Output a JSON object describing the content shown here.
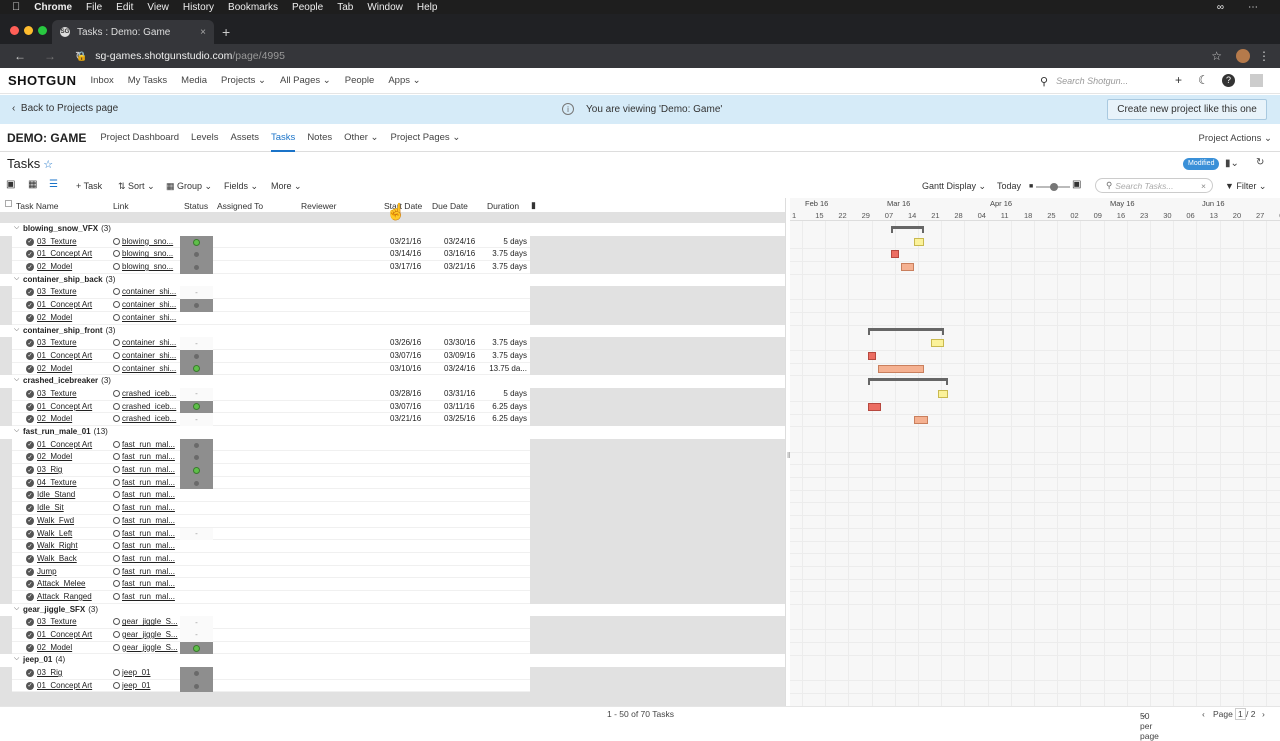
{
  "macbar": {
    "apple": "",
    "app": "Chrome",
    "menus": [
      "File",
      "Edit",
      "View",
      "History",
      "Bookmarks",
      "People",
      "Tab",
      "Window",
      "Help"
    ]
  },
  "browser": {
    "tab_title": "Tasks : Demo: Game",
    "favicon_text": "SG",
    "url_host": "sg-games.shotgunstudio.com",
    "url_path": "/page/4995"
  },
  "sgnav": {
    "logo": "SHOTGUN",
    "links": [
      "Inbox",
      "My Tasks",
      "Media",
      "Projects",
      "All Pages",
      "People",
      "Apps"
    ],
    "search_placeholder": "Search Shotgun..."
  },
  "banner": {
    "back": "Back to Projects page",
    "viewing": "You are viewing 'Demo: Game'",
    "create": "Create new project like this one"
  },
  "project": {
    "name": "DEMO: GAME",
    "tabs": [
      "Project Dashboard",
      "Levels",
      "Assets",
      "Tasks",
      "Notes",
      "Other",
      "Project Pages"
    ],
    "active_tab": "Tasks",
    "actions": "Project Actions"
  },
  "page": {
    "title": "Tasks",
    "modified": "Modified"
  },
  "toolbar": {
    "task": "+ Task",
    "sort": "Sort",
    "group": "Group",
    "fields": "Fields",
    "more": "More",
    "gantt_display": "Gantt Display",
    "today": "Today",
    "search_placeholder": "Search Tasks...",
    "filter": "Filter"
  },
  "columns": [
    "Task Name",
    "Link",
    "Status",
    "Assigned To",
    "Reviewer",
    "Start Date",
    "Due Date",
    "Duration"
  ],
  "groups": [
    {
      "name": "blowing_snow_VFX",
      "count": "(3)",
      "tasks": [
        {
          "name": "03_Texture",
          "link": "blowing_sno...",
          "status": "green",
          "start": "03/21/16",
          "due": "03/24/16",
          "dur": "5 days"
        },
        {
          "name": "01_Concept Art",
          "link": "blowing_sno...",
          "status": "grey",
          "start": "03/14/16",
          "due": "03/16/16",
          "dur": "3.75 days"
        },
        {
          "name": "02_Model",
          "link": "blowing_sno...",
          "status": "grey",
          "start": "03/17/16",
          "due": "03/21/16",
          "dur": "3.75 days"
        }
      ]
    },
    {
      "name": "container_ship_back",
      "count": "(3)",
      "tasks": [
        {
          "name": "03_Texture",
          "link": "container_shi...",
          "status": "dash",
          "start": "",
          "due": "",
          "dur": ""
        },
        {
          "name": "01_Concept Art",
          "link": "container_shi...",
          "status": "grey",
          "start": "",
          "due": "",
          "dur": ""
        },
        {
          "name": "02_Model",
          "link": "container_shi...",
          "status": "none",
          "start": "",
          "due": "",
          "dur": ""
        }
      ]
    },
    {
      "name": "container_ship_front",
      "count": "(3)",
      "tasks": [
        {
          "name": "03_Texture",
          "link": "container_shi...",
          "status": "dash",
          "start": "03/26/16",
          "due": "03/30/16",
          "dur": "3.75 days"
        },
        {
          "name": "01_Concept Art",
          "link": "container_shi...",
          "status": "grey",
          "start": "03/07/16",
          "due": "03/09/16",
          "dur": "3.75 days"
        },
        {
          "name": "02_Model",
          "link": "container_shi...",
          "status": "green",
          "start": "03/10/16",
          "due": "03/24/16",
          "dur": "13.75 da..."
        }
      ]
    },
    {
      "name": "crashed_icebreaker",
      "count": "(3)",
      "tasks": [
        {
          "name": "03_Texture",
          "link": "crashed_iceb...",
          "status": "dash",
          "start": "03/28/16",
          "due": "03/31/16",
          "dur": "5 days"
        },
        {
          "name": "01_Concept Art",
          "link": "crashed_iceb...",
          "status": "green",
          "start": "03/07/16",
          "due": "03/11/16",
          "dur": "6.25 days"
        },
        {
          "name": "02_Model",
          "link": "crashed_iceb...",
          "status": "dash",
          "start": "03/21/16",
          "due": "03/25/16",
          "dur": "6.25 days"
        }
      ]
    },
    {
      "name": "fast_run_male_01",
      "count": "(13)",
      "tasks": [
        {
          "name": "01_Concept Art",
          "link": "fast_run_mal...",
          "status": "grey",
          "start": "",
          "due": "",
          "dur": ""
        },
        {
          "name": "02_Model",
          "link": "fast_run_mal...",
          "status": "grey",
          "start": "",
          "due": "",
          "dur": ""
        },
        {
          "name": "03_Rig",
          "link": "fast_run_mal...",
          "status": "green",
          "start": "",
          "due": "",
          "dur": ""
        },
        {
          "name": "04_Texture",
          "link": "fast_run_mal...",
          "status": "grey",
          "start": "",
          "due": "",
          "dur": ""
        },
        {
          "name": "Idle_Stand",
          "link": "fast_run_mal...",
          "status": "none",
          "start": "",
          "due": "",
          "dur": ""
        },
        {
          "name": "Idle_Sit",
          "link": "fast_run_mal...",
          "status": "none",
          "start": "",
          "due": "",
          "dur": ""
        },
        {
          "name": "Walk_Fwd",
          "link": "fast_run_mal...",
          "status": "none",
          "start": "",
          "due": "",
          "dur": ""
        },
        {
          "name": "Walk_Left",
          "link": "fast_run_mal...",
          "status": "dash",
          "start": "",
          "due": "",
          "dur": ""
        },
        {
          "name": "Walk_Right",
          "link": "fast_run_mal...",
          "status": "none",
          "start": "",
          "due": "",
          "dur": ""
        },
        {
          "name": "Walk_Back",
          "link": "fast_run_mal...",
          "status": "none",
          "start": "",
          "due": "",
          "dur": ""
        },
        {
          "name": "Jump",
          "link": "fast_run_mal...",
          "status": "none",
          "start": "",
          "due": "",
          "dur": ""
        },
        {
          "name": "Attack_Melee",
          "link": "fast_run_mal...",
          "status": "none",
          "start": "",
          "due": "",
          "dur": ""
        },
        {
          "name": "Attack_Ranged",
          "link": "fast_run_mal...",
          "status": "none",
          "start": "",
          "due": "",
          "dur": ""
        }
      ]
    },
    {
      "name": "gear_jiggle_SFX",
      "count": "(3)",
      "tasks": [
        {
          "name": "03_Texture",
          "link": "gear_jiggle_S...",
          "status": "dash",
          "start": "",
          "due": "",
          "dur": ""
        },
        {
          "name": "01_Concept Art",
          "link": "gear_jiggle_S...",
          "status": "dash",
          "start": "",
          "due": "",
          "dur": ""
        },
        {
          "name": "02_Model",
          "link": "gear_jiggle_S...",
          "status": "green",
          "start": "",
          "due": "",
          "dur": ""
        }
      ]
    },
    {
      "name": "jeep_01",
      "count": "(4)",
      "tasks": [
        {
          "name": "03_Rig",
          "link": "jeep_01",
          "status": "grey",
          "start": "",
          "due": "",
          "dur": ""
        },
        {
          "name": "01_Concept Art",
          "link": "jeep_01",
          "status": "grey",
          "start": "",
          "due": "",
          "dur": ""
        }
      ]
    }
  ],
  "gantt": {
    "months": [
      "Feb 16",
      "Mar 16",
      "Apr 16",
      "May 16",
      "Jun 16"
    ],
    "days": [
      "1",
      "15",
      "22",
      "29",
      "07",
      "14",
      "21",
      "28",
      "04",
      "11",
      "18",
      "25",
      "02",
      "09",
      "16",
      "23",
      "30",
      "06",
      "13",
      "20",
      "27",
      "04"
    ]
  },
  "footer": {
    "count": "1 - 50 of 70 Tasks",
    "per_page": "50 per page",
    "page_label": "Page",
    "page": "1",
    "of": "/ 2"
  },
  "colors": {
    "accent": "#1a73c8",
    "banner": "#d6ebf8",
    "green": "#5fbf4a",
    "red": "#ec6d62",
    "yellow": "#fbf29b",
    "salmon": "#f5b191"
  }
}
